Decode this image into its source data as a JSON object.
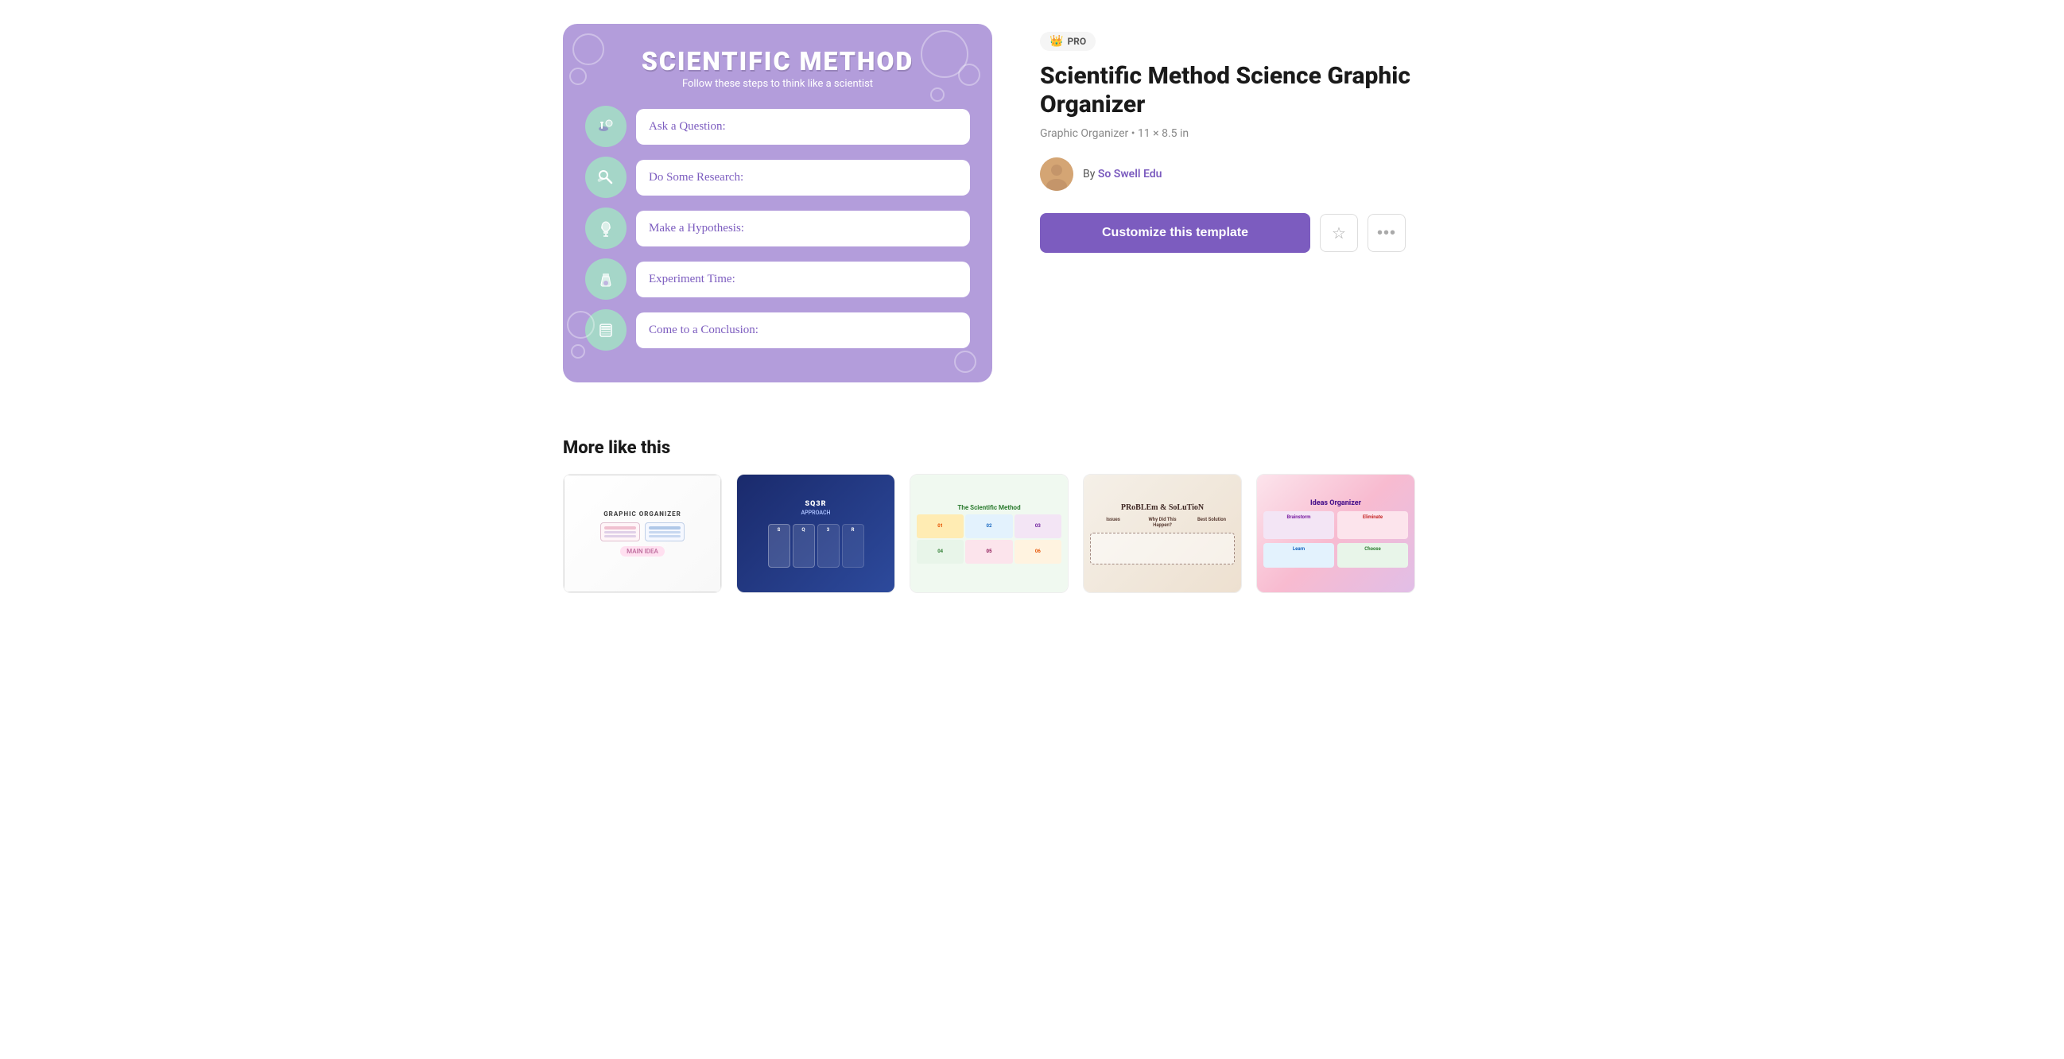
{
  "pro_badge": {
    "icon": "👑",
    "label": "PRO"
  },
  "template": {
    "title": "Scientific Method Science Graphic Organizer",
    "meta": "Graphic Organizer • 11 × 8.5 in"
  },
  "author": {
    "by_label": "By",
    "name": "So Swell Edu"
  },
  "actions": {
    "customize_label": "Customize this template",
    "star_icon": "☆",
    "more_icon": "···"
  },
  "card": {
    "main_title": "SCIENTIFIC METHOD",
    "subtitle": "Follow these steps to think like a scientist",
    "steps": [
      {
        "label": "Ask a Question:",
        "icon": "🔬"
      },
      {
        "label": "Do Some Research:",
        "icon": "🔍"
      },
      {
        "label": "Make a Hypothesis:",
        "icon": "💡"
      },
      {
        "label": "Experiment Time:",
        "icon": "⚗️"
      },
      {
        "label": "Come to a Conclusion:",
        "icon": "📚"
      }
    ]
  },
  "more_section": {
    "title": "More like this",
    "thumbnails": [
      {
        "id": 1,
        "label": "GRAPHIC ORGANIZER",
        "theme": "light"
      },
      {
        "id": 2,
        "label": "SQ3R APPROACH",
        "theme": "dark-blue"
      },
      {
        "id": 3,
        "label": "The Scientific Method",
        "theme": "light-green"
      },
      {
        "id": 4,
        "label": "PROBLEM & SOLUTION",
        "theme": "beige"
      },
      {
        "id": 5,
        "label": "Ideas Organizer",
        "theme": "colorful"
      }
    ]
  }
}
